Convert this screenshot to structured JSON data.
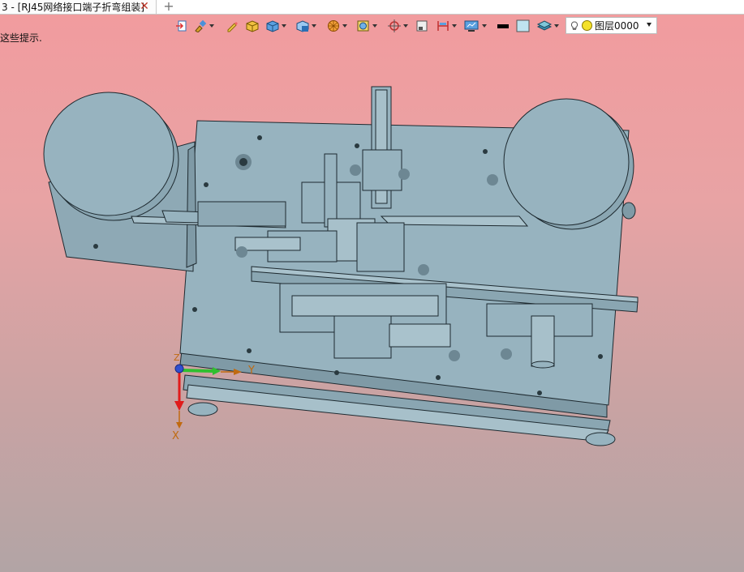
{
  "tab": {
    "title": "3 - [RJ45网络接口端子折弯组装]",
    "close_glyph": "✕",
    "add_glyph": "+"
  },
  "hint_text": "这些提示.",
  "toolbar": {
    "icons": [
      "exit-sketch-icon",
      "brush-icon",
      "pencil-icon",
      "box-solid-icon",
      "cube-icon",
      "cube-view-icon",
      "render-ball-icon",
      "face-icon",
      "origin-icon",
      "square-icon",
      "dimension-icon",
      "display-icon",
      "color-black-swatch",
      "color-light-swatch",
      "layer-stack-icon"
    ],
    "layer": {
      "name": "图层0000"
    }
  },
  "colors": {
    "model_fill": "#97b3bf",
    "model_stroke": "#1e2a30",
    "axis_x": "#e01b1b",
    "axis_y": "#2fbf2f",
    "axis_label": "#c06a10"
  },
  "triad": {
    "x_label": "X",
    "y_label": "Y",
    "z_label": "Z"
  }
}
